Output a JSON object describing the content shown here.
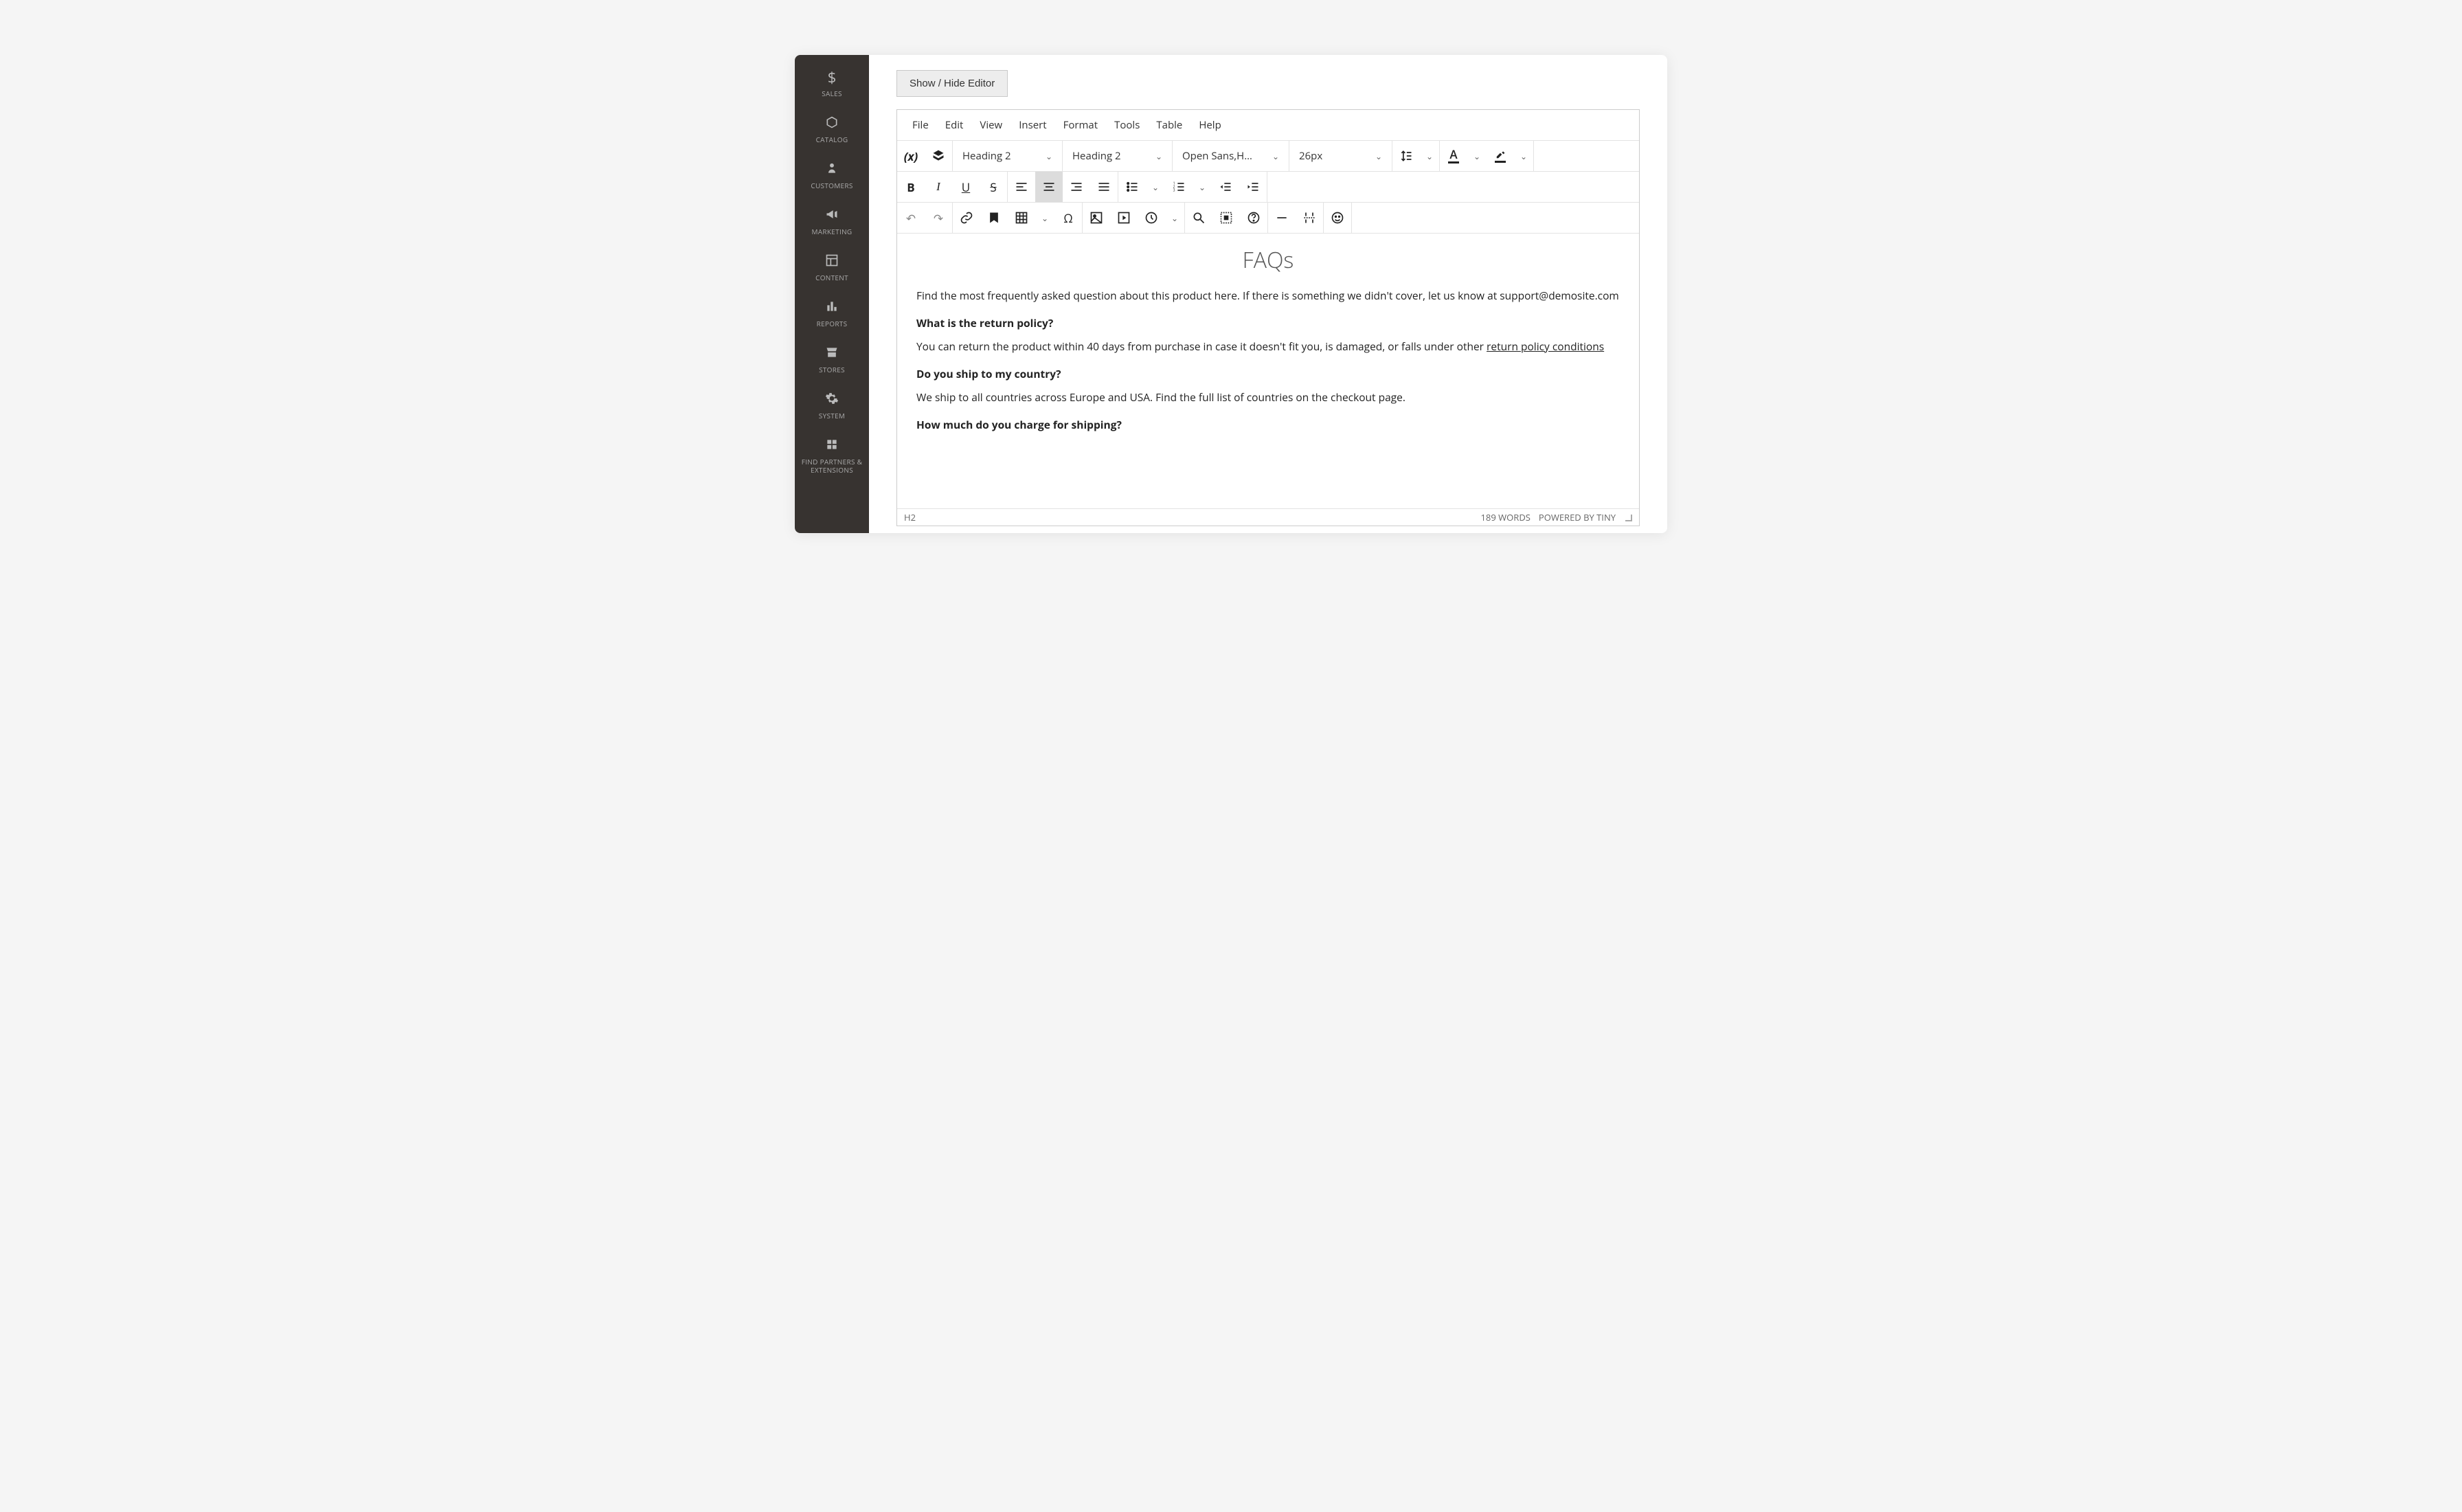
{
  "sidebar": {
    "items": [
      {
        "label": "SALES",
        "icon": "$"
      },
      {
        "label": "CATALOG",
        "icon": "cube"
      },
      {
        "label": "CUSTOMERS",
        "icon": "person"
      },
      {
        "label": "MARKETING",
        "icon": "megaphone"
      },
      {
        "label": "CONTENT",
        "icon": "layout"
      },
      {
        "label": "REPORTS",
        "icon": "bars"
      },
      {
        "label": "STORES",
        "icon": "storefront"
      },
      {
        "label": "SYSTEM",
        "icon": "gear"
      },
      {
        "label": "FIND PARTNERS & EXTENSIONS",
        "icon": "blocks"
      }
    ]
  },
  "toggle_button": "Show / Hide Editor",
  "menubar": [
    "File",
    "Edit",
    "View",
    "Insert",
    "Format",
    "Tools",
    "Table",
    "Help"
  ],
  "toolbar": {
    "block_format_1": "Heading 2",
    "block_format_2": "Heading 2",
    "font_family": "Open Sans,H…",
    "font_size": "26px"
  },
  "content": {
    "title": "FAQs",
    "intro": "Find the most frequently asked question about this product here. If there is something we didn't cover, let us know at support@demosite.com",
    "q1": "What is the return policy?",
    "a1_pre": "You can return the product within 40 days from purchase in case it doesn't fit you, is damaged, or falls under other ",
    "a1_link": "return policy conditions",
    "q2": "Do you ship to my country?",
    "a2": "We ship to all countries across Europe and USA. Find the full list of countries on the checkout page.",
    "q3": "How much do you charge for shipping?"
  },
  "statusbar": {
    "path": "H2",
    "words": "189 WORDS",
    "powered": "POWERED BY TINY"
  }
}
